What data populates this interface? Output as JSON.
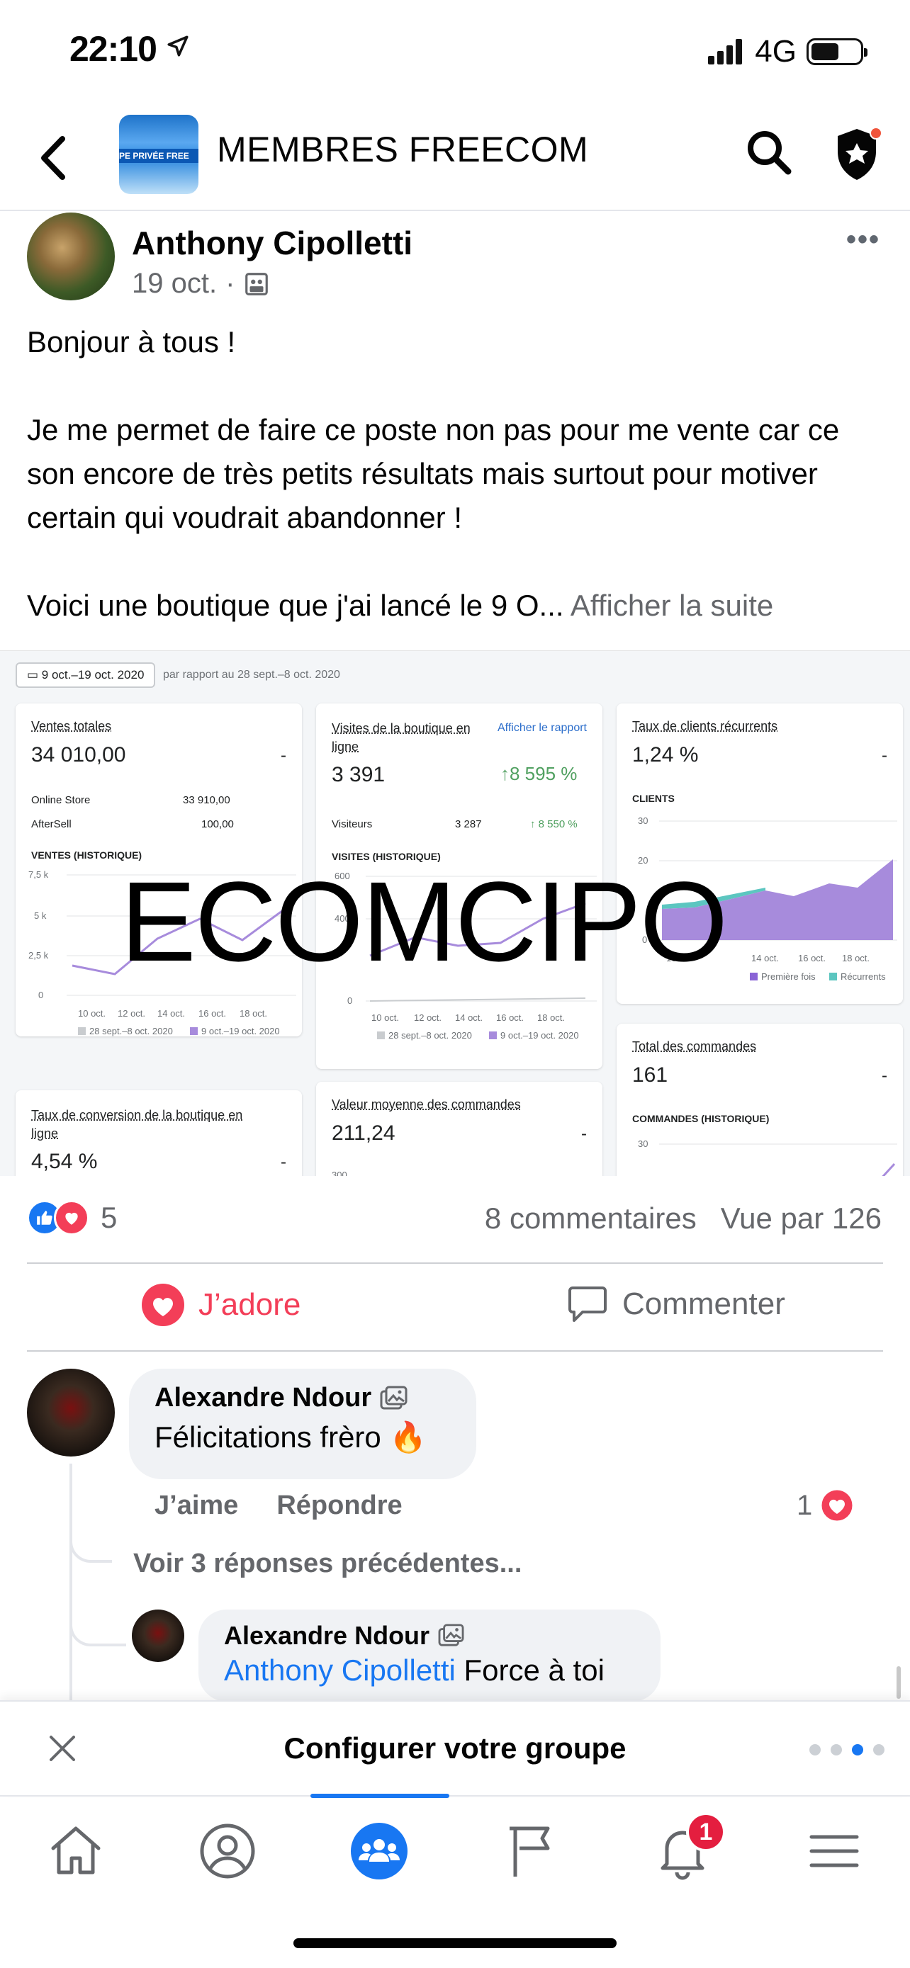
{
  "status_bar": {
    "time": "22:10",
    "network": "4G"
  },
  "header": {
    "group_name": "MEMBRES FREECOM",
    "thumb_text": "PE PRIVÉE  FREE"
  },
  "post": {
    "author": "Anthony Cipolletti",
    "date": "19 oct.",
    "separator": "·",
    "more": "•••",
    "paragraphs": [
      "Bonjour à tous !",
      "Je me permet de faire ce poste non pas pour me vente car ce son encore de très petits résultats mais surtout pour motiver certain qui voudrait abandonner !"
    ],
    "last_line": "Voici une boutique que j'ai lancé le 9 O... ",
    "see_more": "Afficher la suite"
  },
  "dashboard": {
    "date_range": "9 oct.–19 oct. 2020",
    "compare_text": "par rapport au 28 sept.–8 oct. 2020",
    "watermark": "ECOMCIPO",
    "card_sales": {
      "title": "Ventes totales",
      "value": "34 010,00",
      "dash": "-",
      "rows": [
        {
          "label": "Online Store",
          "value": "33 910,00"
        },
        {
          "label": "AfterSell",
          "value": "100,00"
        }
      ],
      "chart_caption": "VENTES (HISTORIQUE)",
      "y_ticks": [
        "7,5 k",
        "5 k",
        "2,5 k",
        "0"
      ],
      "x_ticks": [
        "10 oct.",
        "12 oct.",
        "14 oct.",
        "16 oct.",
        "18 oct."
      ],
      "legend_a": "28 sept.–8 oct. 2020",
      "legend_b": "9 oct.–19 oct. 2020"
    },
    "card_visits": {
      "title": "Visites de la boutique en ligne",
      "link": "Afficher le rapport",
      "value": "3 391",
      "change": "↑8 595 %",
      "row_label": "Visiteurs",
      "row_value": "3 287",
      "row_change": "↑ 8 550 %",
      "chart_caption": "VISITES (HISTORIQUE)",
      "y_ticks": [
        "600",
        "400",
        "0"
      ],
      "x_ticks": [
        "10 oct.",
        "12 oct.",
        "14 oct.",
        "16 oct.",
        "18 oct."
      ],
      "legend_a": "28 sept.–8 oct. 2020",
      "legend_b": "9 oct.–19 oct. 2020"
    },
    "card_returning": {
      "title": "Taux de clients récurrents",
      "value": "1,24 %",
      "dash": "-",
      "chart_caption": "CLIENTS",
      "y_ticks": [
        "30",
        "20",
        "0"
      ],
      "x_ticks": [
        "10 oc",
        "14 oct.",
        "16 oct.",
        "18 oct."
      ],
      "legend_a": "Première fois",
      "legend_b": "Récurrents"
    },
    "card_orders": {
      "title": "Total des commandes",
      "value": "161",
      "dash": "-",
      "chart_caption": "COMMANDES (HISTORIQUE)",
      "y_tick": "30"
    },
    "card_conversion": {
      "title": "Taux de conversion de la boutique en ligne",
      "value": "4,54 %",
      "dash": "-"
    },
    "card_aov": {
      "title": "Valeur moyenne des commandes",
      "value": "211,24",
      "dash": "-",
      "y_tick": "300"
    }
  },
  "reactions": {
    "count": "5",
    "comments": "8 commentaires",
    "views": "Vue par 126"
  },
  "actions": {
    "love": "J’adore",
    "comment": "Commenter"
  },
  "comments": [
    {
      "author": "Alexandre Ndour",
      "text": "Félicitations frèro 🔥",
      "like": "J’aime",
      "reply": "Répondre",
      "reaction_count": "1",
      "previous_replies": "Voir 3 réponses précédentes..."
    }
  ],
  "reply": {
    "author": "Alexandre Ndour",
    "mention": "Anthony Cipolletti",
    "text": " Force à toi"
  },
  "banner": {
    "title": "Configurer votre groupe"
  },
  "nav": {
    "notification_count": "1"
  },
  "colors": {
    "accent": "#1877f2",
    "love": "#f33e58",
    "muted": "#65676b",
    "chart_purple": "#a78bdc",
    "chart_teal": "#5cc6c0"
  }
}
